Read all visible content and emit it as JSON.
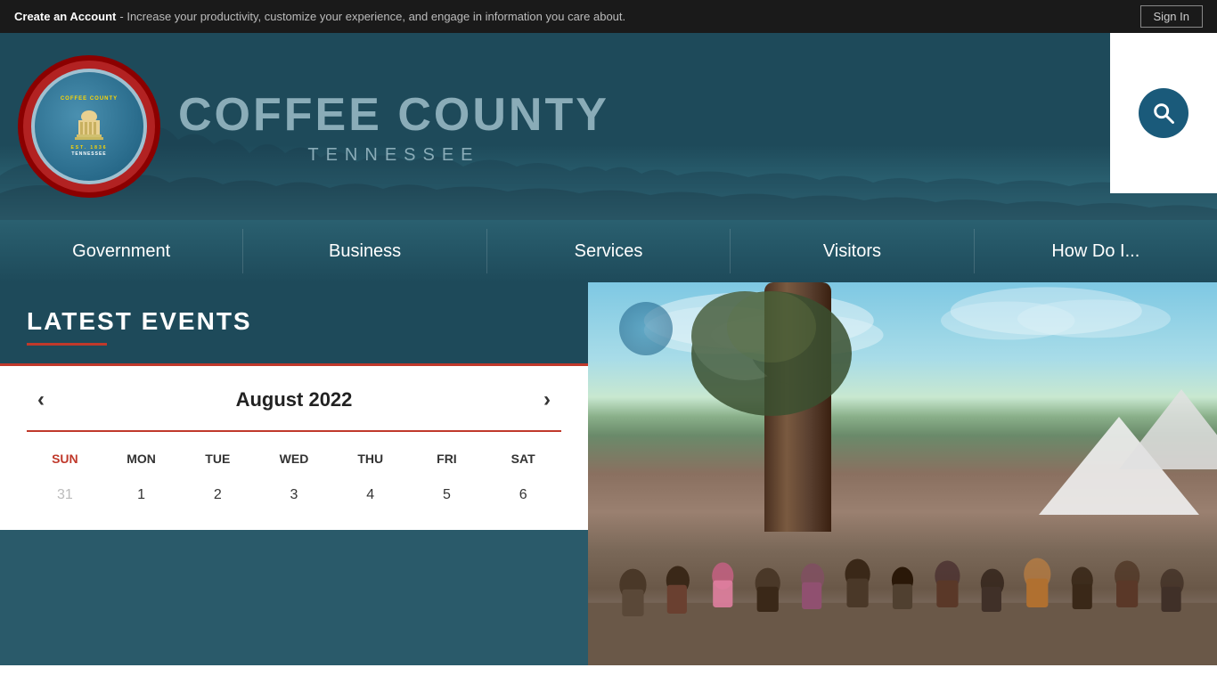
{
  "topbar": {
    "create_account_label": "Create an Account",
    "tagline": "- Increase your productivity, customize your experience, and engage in information you care about.",
    "sign_in_label": "Sign In"
  },
  "header": {
    "county_name": "COFFEE COUNTY",
    "state_name": "TENNESSEE",
    "logo_text_top": "COFFEE COUNTY",
    "logo_est": "EST.",
    "logo_year": "1836",
    "logo_state": "TENNESSEE"
  },
  "nav": {
    "items": [
      {
        "label": "Government",
        "id": "government"
      },
      {
        "label": "Business",
        "id": "business"
      },
      {
        "label": "Services",
        "id": "services"
      },
      {
        "label": "Visitors",
        "id": "visitors"
      },
      {
        "label": "How Do I...",
        "id": "how-do-i"
      }
    ]
  },
  "calendar": {
    "section_title": "LATEST EVENTS",
    "month_year": "August 2022",
    "prev_label": "‹",
    "next_label": "›",
    "day_headers": [
      "SUN",
      "MON",
      "TUE",
      "WED",
      "THU",
      "FRI",
      "SAT"
    ],
    "weeks": [
      [
        {
          "day": "31",
          "other": true
        },
        {
          "day": "1",
          "other": false
        },
        {
          "day": "2",
          "other": false
        },
        {
          "day": "3",
          "other": false
        },
        {
          "day": "4",
          "other": false
        },
        {
          "day": "5",
          "other": false
        },
        {
          "day": "6",
          "other": false
        }
      ]
    ]
  },
  "search": {
    "icon_label": "search"
  }
}
